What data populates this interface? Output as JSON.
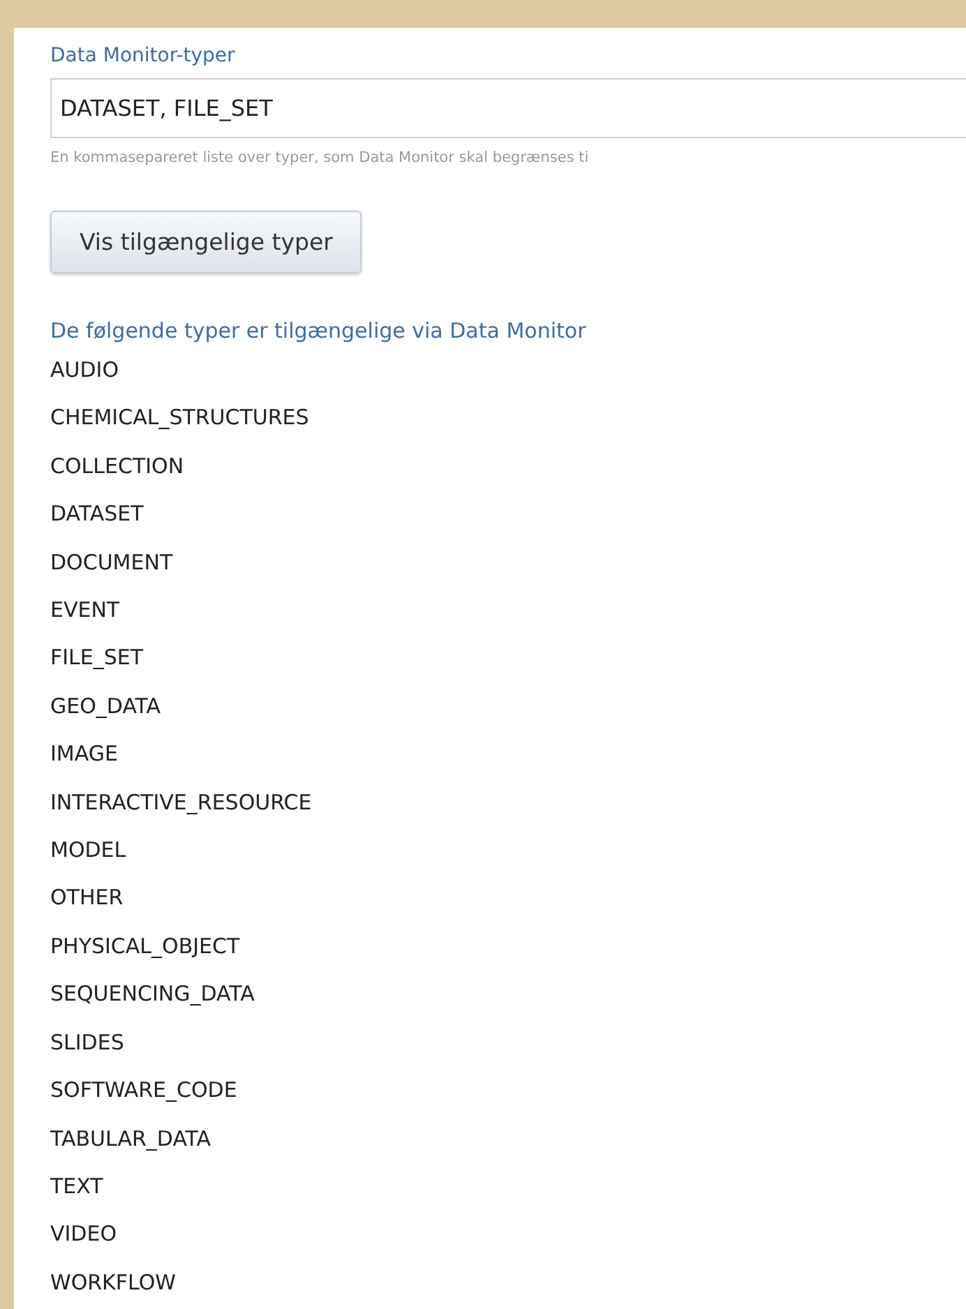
{
  "field": {
    "label": "Data Monitor-typer",
    "value": "DATASET, FILE_SET",
    "hint": "En kommasepareret liste over typer, som Data Monitor skal begrænses ti"
  },
  "button": "Vis tilgængelige typer",
  "types": {
    "heading": "De følgende typer er tilgængelige via Data Monitor",
    "items": [
      "AUDIO",
      "CHEMICAL_STRUCTURES",
      "COLLECTION",
      "DATASET",
      "DOCUMENT",
      "EVENT",
      "FILE_SET",
      "GEO_DATA",
      "IMAGE",
      "INTERACTIVE_RESOURCE",
      "MODEL",
      "OTHER",
      "PHYSICAL_OBJECT",
      "SEQUENCING_DATA",
      "SLIDES",
      "SOFTWARE_CODE",
      "TABULAR_DATA",
      "TEXT",
      "VIDEO",
      "WORKFLOW"
    ]
  }
}
